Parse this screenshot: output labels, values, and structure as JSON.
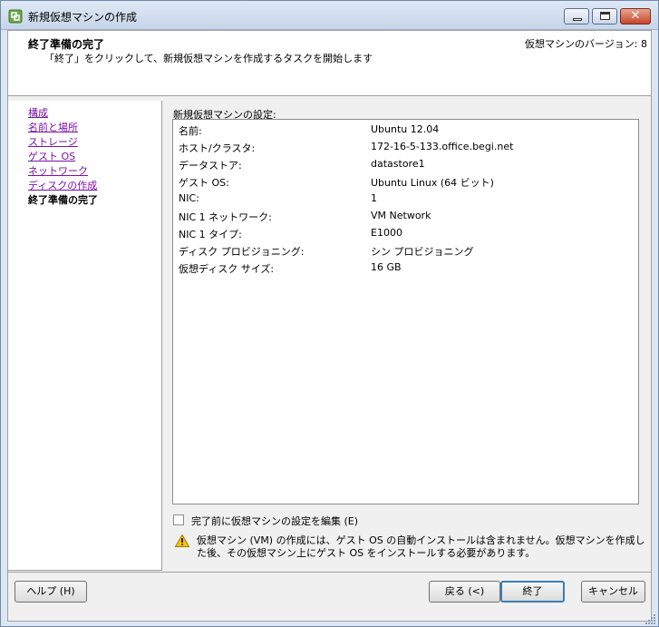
{
  "window": {
    "title": "新規仮想マシンの作成",
    "accent": "#dfe9f5"
  },
  "header": {
    "title": "終了準備の完了",
    "subtitle": "「終了」をクリックして、新規仮想マシンを作成するタスクを開始します",
    "version": "仮想マシンのバージョン: 8"
  },
  "steps": [
    {
      "label": "構成",
      "state": "link"
    },
    {
      "label": "名前と場所",
      "state": "link"
    },
    {
      "label": "ストレージ",
      "state": "link"
    },
    {
      "label": "ゲスト OS",
      "state": "link"
    },
    {
      "label": "ネットワーク",
      "state": "link"
    },
    {
      "label": "ディスクの作成",
      "state": "link"
    },
    {
      "label": "終了準備の完了",
      "state": "current"
    }
  ],
  "settings": {
    "label": "新規仮想マシンの設定:",
    "rows": [
      {
        "key": "名前:",
        "value": "Ubuntu 12.04"
      },
      {
        "key": "ホスト/クラスタ:",
        "value": "172-16-5-133.office.begi.net"
      },
      {
        "key": "データストア:",
        "value": "datastore1"
      },
      {
        "key": "ゲスト OS:",
        "value": "Ubuntu Linux (64 ビット)"
      },
      {
        "key": "NIC:",
        "value": "1"
      },
      {
        "key": "NIC 1 ネットワーク:",
        "value": "VM Network"
      },
      {
        "key": "NIC 1 タイプ:",
        "value": "E1000"
      },
      {
        "key": "ディスク プロビジョニング:",
        "value": "シン プロビジョニング"
      },
      {
        "key": "仮想ディスク サイズ:",
        "value": "16 GB"
      }
    ]
  },
  "edit_checkbox": {
    "label": "完了前に仮想マシンの設定を編集 (E)",
    "checked": false
  },
  "warning": {
    "icon": "warning-icon",
    "text": "仮想マシン (VM) の作成には、ゲスト OS の自動インストールは含まれません。仮想マシンを作成した後、その仮想マシン上にゲスト OS をインストールする必要があります。"
  },
  "buttons": {
    "help": "ヘルプ (H)",
    "back": "戻る (<)",
    "finish": "終了",
    "cancel": "キャンセル"
  }
}
